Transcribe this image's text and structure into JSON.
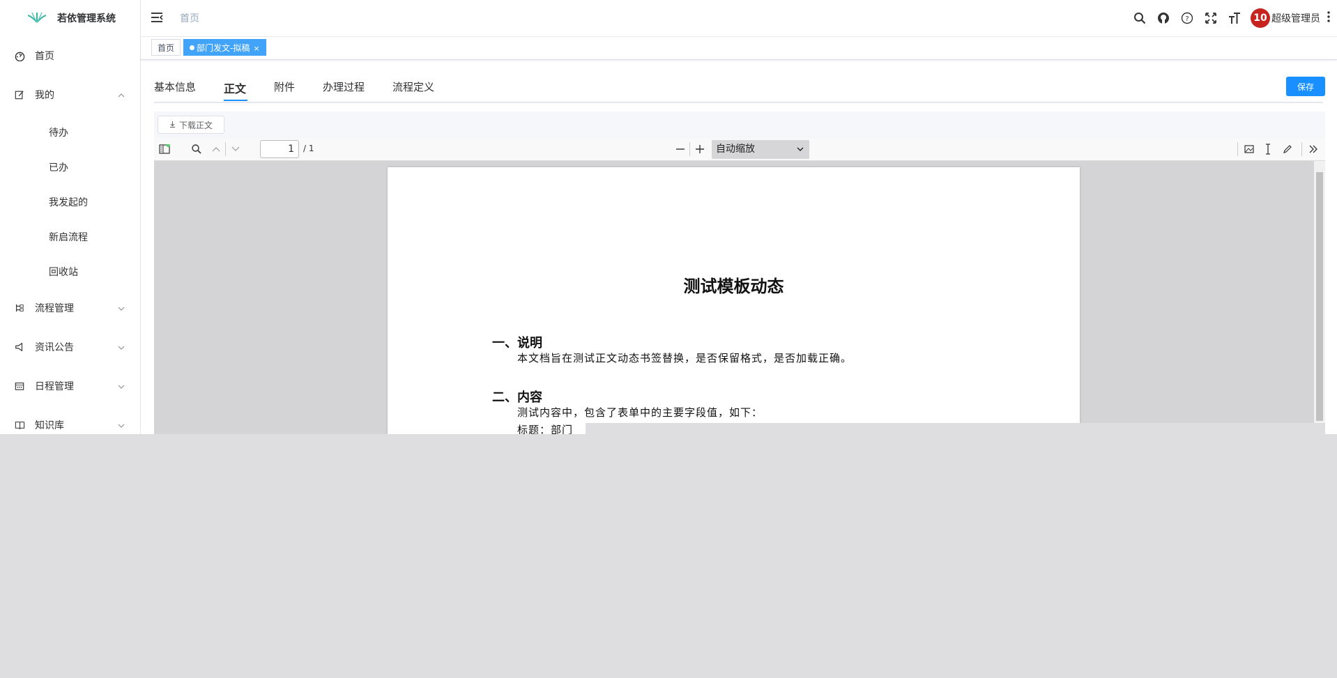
{
  "app": {
    "title": "若依管理系统"
  },
  "sidebar": {
    "items": [
      {
        "label": "首页",
        "icon": "dashboard-icon"
      },
      {
        "label": "我的",
        "icon": "edit-icon",
        "expanded": true,
        "children": [
          "待办",
          "已办",
          "我发起的",
          "新启流程",
          "回收站"
        ]
      },
      {
        "label": "流程管理",
        "icon": "tree-icon"
      },
      {
        "label": "资讯公告",
        "icon": "megaphone-icon"
      },
      {
        "label": "日程管理",
        "icon": "calendar-icon"
      },
      {
        "label": "知识库",
        "icon": "book-icon"
      }
    ]
  },
  "header": {
    "breadcrumb": "首页",
    "avatar_text": "10",
    "user_name": "超级管理员",
    "tools": [
      "search-icon",
      "github-icon",
      "help-icon",
      "fullscreen-icon",
      "font-size-icon"
    ]
  },
  "tags": {
    "items": [
      {
        "label": "首页"
      },
      {
        "label": "部门发文-拟稿",
        "active": true,
        "close": "×"
      }
    ]
  },
  "tabs": {
    "items": [
      "基本信息",
      "正文",
      "附件",
      "办理过程",
      "流程定义"
    ],
    "active": "正文",
    "save_label": "保存"
  },
  "viewer": {
    "download_label": "下载正文",
    "page_current": "1",
    "page_total": "/ 1",
    "zoom": "自动缩放"
  },
  "document": {
    "title": "测试模板动态",
    "section1_heading": "一、说明",
    "section1_text": "本文档旨在测试正文动态书签替换，是否保留格式，是否加载正确。",
    "section2_heading": "二、内容",
    "section2_text": "测试内容中，包含了表单中的主要字段值，如下：",
    "section2_line2": "标题：部门"
  },
  "colors": {
    "primary": "#1890ff",
    "tag_active": "#42a4f8",
    "avatar": "#c7231f"
  }
}
